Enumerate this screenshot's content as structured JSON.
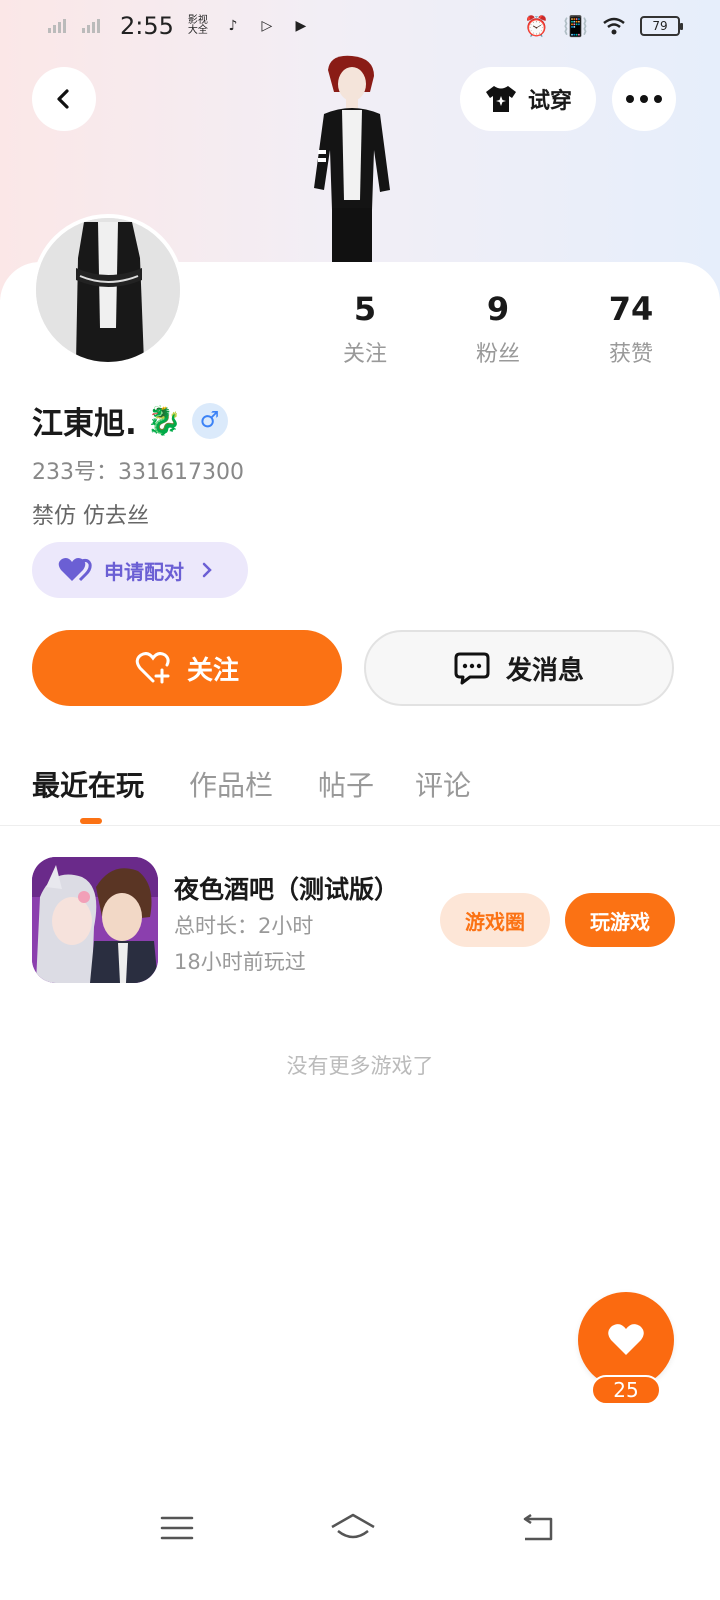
{
  "status_bar": {
    "time": "2:55",
    "app_icons": [
      "影视大全",
      "♪",
      "▷",
      "▶"
    ],
    "battery": "79"
  },
  "header": {
    "try_on_label": "试穿"
  },
  "profile": {
    "name": "江東旭.",
    "name_emoji": "🐉",
    "gender_symbol": "♂",
    "uid": "233号：331617300",
    "bio": "禁仿 仿去丝",
    "pair_label": "申请配对",
    "stats": [
      {
        "value": "5",
        "label": "关注"
      },
      {
        "value": "9",
        "label": "粉丝"
      },
      {
        "value": "74",
        "label": "获赞"
      }
    ]
  },
  "actions": {
    "follow_label": "关注",
    "message_label": "发消息"
  },
  "tabs": [
    {
      "label": "最近在玩",
      "active": true
    },
    {
      "label": "作品栏",
      "active": false
    },
    {
      "label": "帖子",
      "active": false
    },
    {
      "label": "评论",
      "active": false
    }
  ],
  "games": [
    {
      "title": "夜色酒吧（测试版）",
      "duration": "总时长：2小时",
      "last_played": "18小时前玩过",
      "circle_label": "游戏圈",
      "play_label": "玩游戏"
    }
  ],
  "empty_text": "没有更多游戏了",
  "likes": {
    "count": "25"
  },
  "colors": {
    "accent": "#fb7214",
    "pair": "#6b5fd4",
    "gender": "#3b82f6"
  }
}
